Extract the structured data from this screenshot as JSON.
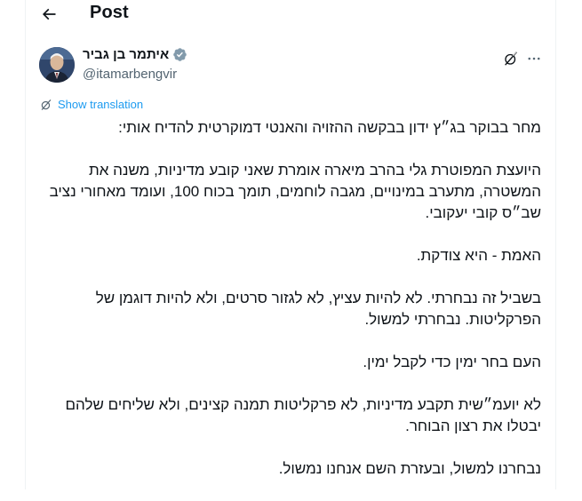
{
  "header": {
    "title": "Post"
  },
  "author": {
    "name": "איתמר בן גביר",
    "handle": "@itamarbengvir",
    "verified": true
  },
  "translate": {
    "label": "Show translation"
  },
  "post": {
    "paragraphs": [
      "מחר בבוקר בג״ץ ידון בבקשה ההזויה והאנטי דמוקרטית להדיח אותי:",
      "היועצת המפוטרת גלי בהרב מיארה אומרת שאני קובע מדיניות, משנה את המשטרה, מתערב במינויים, מגבה לוחמים, תומך בכוח 100, ועומד מאחורי נציב שב״ס קובי יעקובי.",
      "האמת - היא צודקת.",
      "בשביל זה נבחרתי. לא להיות עציץ, לא לגזור סרטים, ולא להיות דוגמן של הפרקליטות. נבחרתי למשול.",
      "העם בחר ימין כדי לקבל ימין.",
      "לא יועמ״שית תקבע מדיניות, לא פרקליטות תמנה קצינים, ולא שליחים שלהם יבטלו את רצון הבוחר.",
      "נבחרנו למשול, ובעזרת השם אנחנו נמשול."
    ]
  },
  "colors": {
    "accent": "#1d9bf0",
    "secondary_text": "#536471",
    "border": "#eff3f4"
  },
  "icons": {
    "back": "arrow-left-icon",
    "verified": "verified-badge-icon",
    "grok": "grok-icon",
    "more": "more-horizontal-icon",
    "translate": "translate-icon"
  }
}
